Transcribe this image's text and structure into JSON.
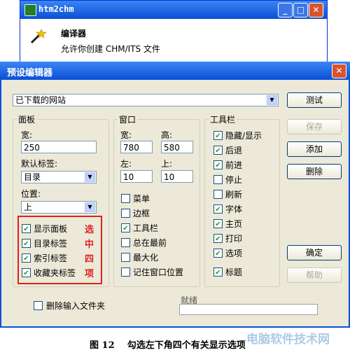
{
  "bg_window": {
    "title": "htm2chm",
    "header_title": "编译器",
    "header_subtitle": "允许你创建 CHM/ITS 文件"
  },
  "dialog": {
    "title": "预设编辑器",
    "close_glyph": "✕",
    "site_select": "已下载的网站",
    "panel_group": {
      "title": "面板",
      "width_label": "宽:",
      "width_value": "250",
      "default_tab_label": "默认标签:",
      "default_tab_value": "目录",
      "position_label": "位置:",
      "position_value": "上",
      "checks": [
        {
          "label": "显示面板",
          "checked": true
        },
        {
          "label": "目录标签",
          "checked": true
        },
        {
          "label": "索引标签",
          "checked": true
        },
        {
          "label": "收藏夹标签",
          "checked": true
        }
      ]
    },
    "annotation": [
      "选",
      "中",
      "四",
      "项"
    ],
    "window_group": {
      "title": "窗口",
      "width_label": "宽:",
      "width_value": "780",
      "height_label": "高:",
      "height_value": "580",
      "left_label": "左:",
      "left_value": "10",
      "top_label": "上:",
      "top_value": "10",
      "checks": [
        {
          "label": "菜单",
          "checked": false
        },
        {
          "label": "边框",
          "checked": false
        },
        {
          "label": "工具栏",
          "checked": true
        },
        {
          "label": "总在最前",
          "checked": false
        },
        {
          "label": "最大化",
          "checked": false
        },
        {
          "label": "记住窗口位置",
          "checked": false
        }
      ]
    },
    "toolbar_group": {
      "title": "工具栏",
      "checks": [
        {
          "label": "隐藏/显示",
          "checked": true
        },
        {
          "label": "后退",
          "checked": true
        },
        {
          "label": "前进",
          "checked": true
        },
        {
          "label": "停止",
          "checked": false
        },
        {
          "label": "刷新",
          "checked": false
        },
        {
          "label": "字体",
          "checked": true
        },
        {
          "label": "主页",
          "checked": true
        },
        {
          "label": "打印",
          "checked": true
        },
        {
          "label": "选项",
          "checked": true
        },
        {
          "label": "标题",
          "checked": true
        }
      ]
    },
    "buttons": {
      "test": "测试",
      "save": "保存",
      "add": "添加",
      "delete": "删除",
      "ok": "确定",
      "help": "帮助"
    }
  },
  "lower": {
    "delete_input_label": "删除输入文件夹",
    "status_label": "就绪"
  },
  "caption": "图 12    勾选左下角四个有关显示选项",
  "watermark": "电脑软件技术网",
  "colors": {
    "dialog_bg": "#ece9d8",
    "title_blue": "#0a50d8",
    "annotation_red": "#e02020"
  }
}
